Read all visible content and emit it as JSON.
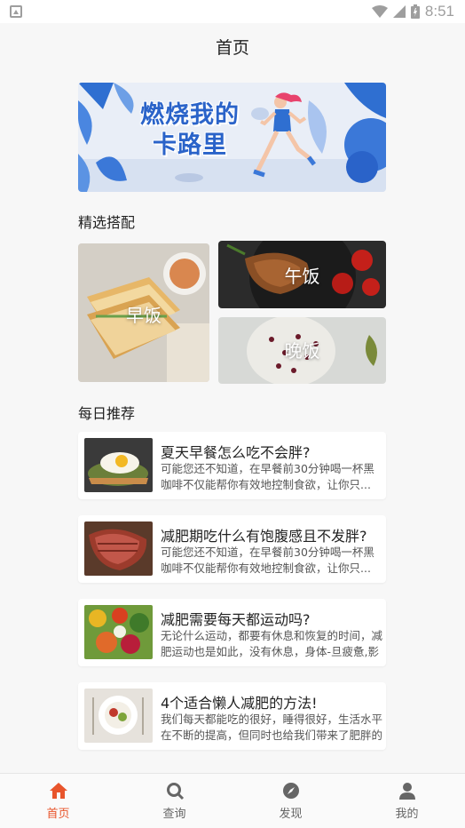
{
  "status_bar": {
    "time": "8:51"
  },
  "header": {
    "title": "首页"
  },
  "banner": {
    "line1": "燃烧我的",
    "line2": "卡路里"
  },
  "featured": {
    "title": "精选搭配",
    "breakfast": "早饭",
    "lunch": "午饭",
    "dinner": "晚饭"
  },
  "daily": {
    "title": "每日推荐",
    "items": [
      {
        "title": "夏天早餐怎么吃不会胖?",
        "desc": "可能您还不知道，在早餐前30分钟喝一杯黑咖啡不仅能帮你有效地控制食欲，让你只..."
      },
      {
        "title": "减肥期吃什么有饱腹感且不发胖?",
        "desc": "可能您还不知道，在早餐前30分钟喝一杯黑咖啡不仅能帮你有效地控制食欲，让你只..."
      },
      {
        "title": "减肥需要每天都运动吗?",
        "desc": "无论什么运动，都要有休息和恢复的时间，减肥运动也是如此，没有休息，身体-旦疲惫,影响健康"
      },
      {
        "title": "4个适合懒人减肥的方法!",
        "desc": "我们每天都能吃的很好，睡得很好，生活水平在不断的提高，但同时也给我们带来了肥胖的危机，身体越肥胖就越容易引起疾病"
      }
    ]
  },
  "tabs": [
    {
      "label": "首页",
      "icon": "home-icon",
      "active": true
    },
    {
      "label": "查询",
      "icon": "search-icon",
      "active": false
    },
    {
      "label": "发现",
      "icon": "compass-icon",
      "active": false
    },
    {
      "label": "我的",
      "icon": "user-icon",
      "active": false
    }
  ],
  "colors": {
    "accent": "#e8552c",
    "inactive": "#666666"
  }
}
